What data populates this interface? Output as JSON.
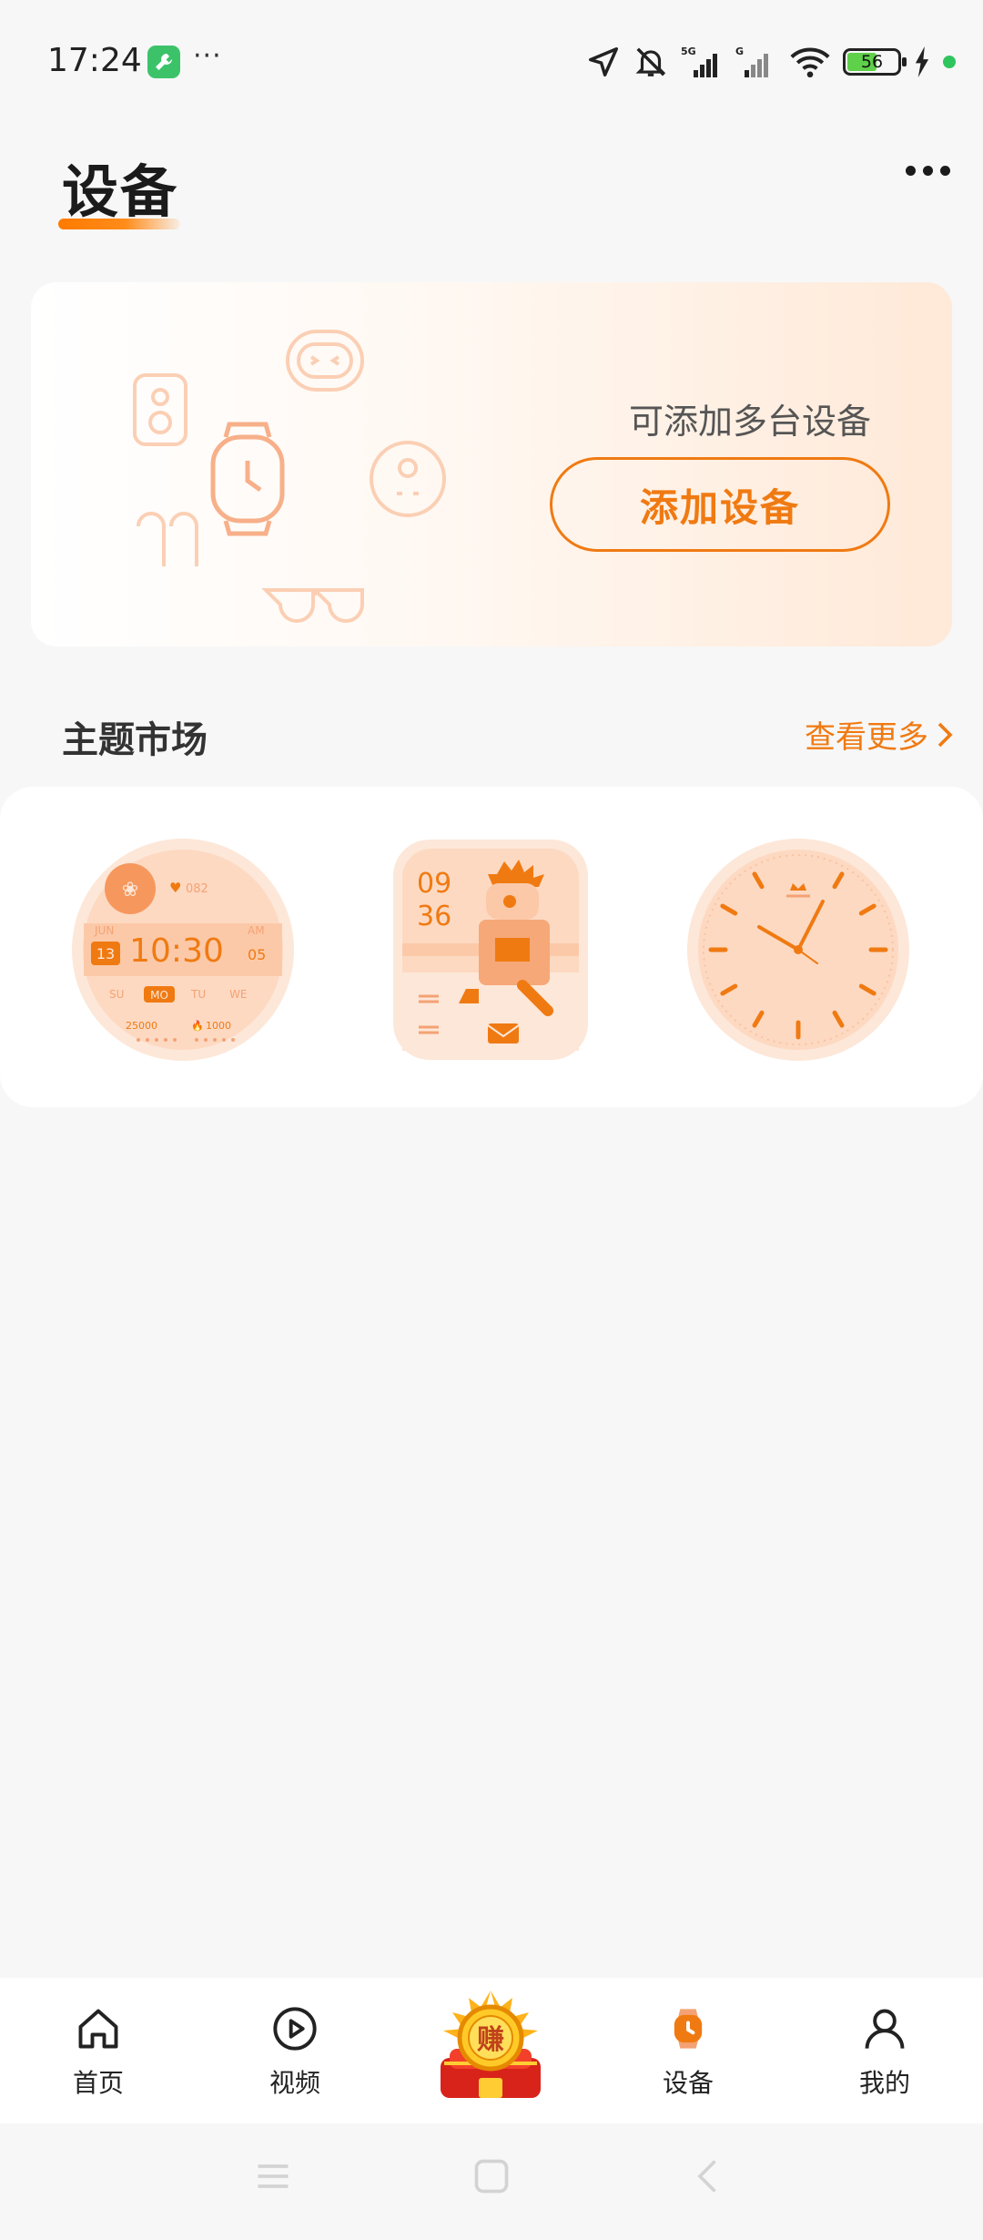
{
  "status_bar": {
    "time": "17:24",
    "more": "···",
    "battery_level": "56",
    "icons": [
      "location-icon",
      "mute-bell-icon",
      "signal-5g-icon",
      "signal-g-icon",
      "wifi-icon",
      "battery-icon",
      "charging-icon"
    ]
  },
  "header": {
    "title": "设备"
  },
  "device_card": {
    "hint": "可添加多台设备",
    "add_button_label": "添加设备"
  },
  "theme_market": {
    "title": "主题市场",
    "view_more": "查看更多",
    "items": [
      {
        "name": "watch-face-digital",
        "time": "10:30",
        "month": "JUN",
        "date": "13",
        "ampm": "AM",
        "hour_extra": "05",
        "heart": "082",
        "days": [
          "SU",
          "MO",
          "TU",
          "WE"
        ],
        "active_day": "MO",
        "steps": "25000",
        "calories": "1000"
      },
      {
        "name": "watch-face-character",
        "hours": "09",
        "minutes": "36"
      },
      {
        "name": "watch-face-analog"
      }
    ]
  },
  "bottom_nav": {
    "items": [
      {
        "label": "首页",
        "icon": "home-icon"
      },
      {
        "label": "视频",
        "icon": "play-circle-icon"
      },
      {
        "label": "赚",
        "icon": "earn-coin-icon"
      },
      {
        "label": "设备",
        "icon": "watch-icon",
        "active": true
      },
      {
        "label": "我的",
        "icon": "person-icon"
      }
    ]
  },
  "colors": {
    "accent": "#f07a12",
    "accent_light": "#ffd9bd",
    "background": "#f7f7f7"
  }
}
